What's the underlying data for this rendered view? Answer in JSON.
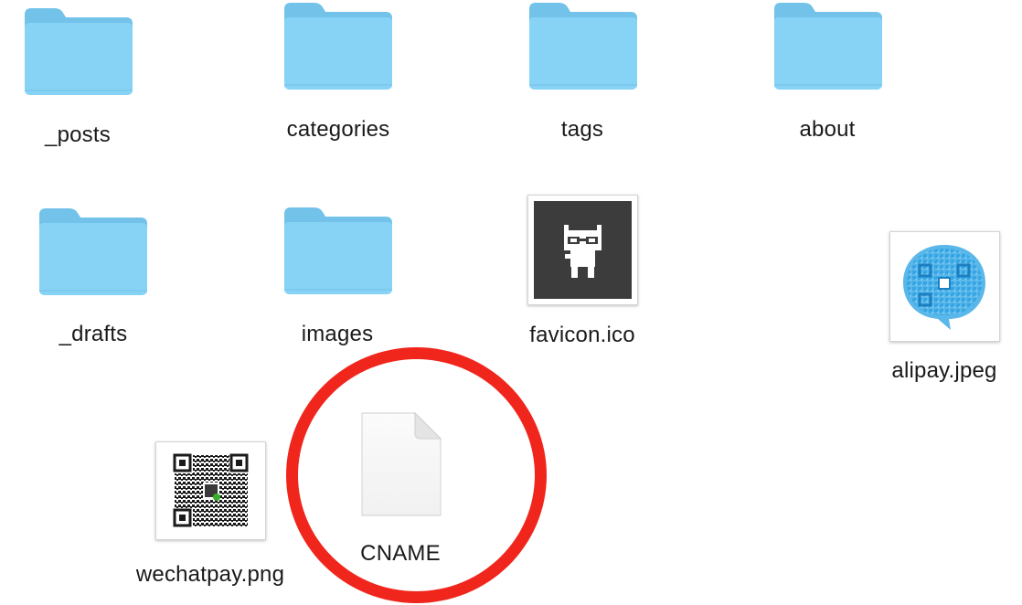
{
  "items": [
    {
      "name": "_posts",
      "type": "folder"
    },
    {
      "name": "categories",
      "type": "folder"
    },
    {
      "name": "tags",
      "type": "folder"
    },
    {
      "name": "about",
      "type": "folder"
    },
    {
      "name": "_drafts",
      "type": "folder"
    },
    {
      "name": "images",
      "type": "folder"
    },
    {
      "name": "favicon.ico",
      "type": "image",
      "icon": "octocat-pixel-icon"
    },
    {
      "name": "alipay.jpeg",
      "type": "image",
      "icon": "alipay-qr-icon"
    },
    {
      "name": "wechatpay.png",
      "type": "image",
      "icon": "wechat-qr-icon"
    },
    {
      "name": "CNAME",
      "type": "document",
      "icon": "blank-document-icon",
      "highlighted": true
    }
  ],
  "colors": {
    "folder_body": "#86d3f5",
    "folder_tab": "#72c2ea",
    "annotation_circle": "#f0261d",
    "favicon_background": "#3c3c3c",
    "alipay_qr": "#2ea3e2",
    "wechat_qr": "#1a1a1a",
    "wechat_accent": "#3aae2b"
  }
}
